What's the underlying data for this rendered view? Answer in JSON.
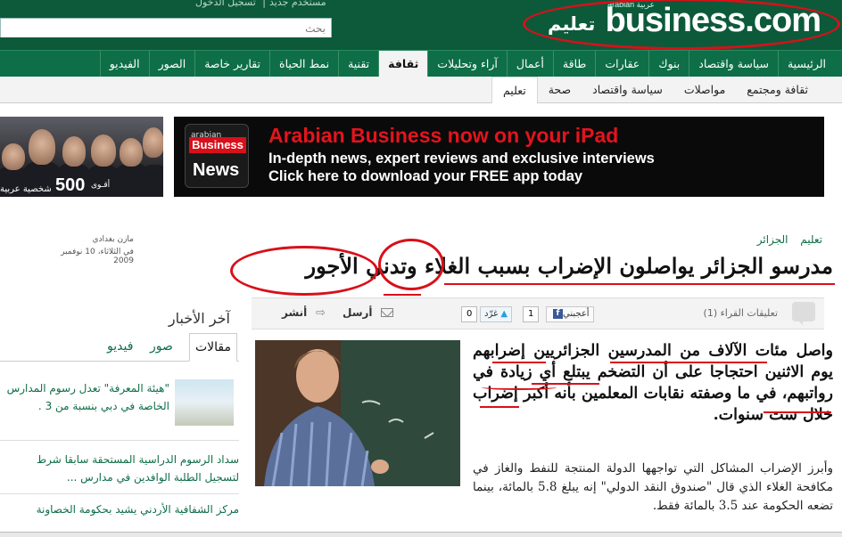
{
  "header": {
    "login_link": "تسجيل الدخول",
    "new_user_link": "مستخدم جديد",
    "search_placeholder": "بحث",
    "logo_small": "arabian عربية",
    "logo_main": "business.com",
    "logo_section": "تعليم"
  },
  "nav": {
    "items": [
      "الرئيسية",
      "سياسة واقتصاد",
      "بنوك",
      "عقارات",
      "طاقة",
      "أعمال",
      "آراء وتحليلات",
      "ثقافة",
      "تقنية",
      "نمط الحياة",
      "تقارير خاصة",
      "الصور",
      "الفيديو"
    ]
  },
  "subnav": {
    "items": [
      "ثقافة ومجتمع",
      "مواصلات",
      "سياسة واقتصاد",
      "صحة",
      "تعليم"
    ]
  },
  "banner_left": {
    "number": "500",
    "caption_right": "أقـوى",
    "caption_left": "شخصية عربية"
  },
  "banner_ipad": {
    "logo_small": "arabian",
    "logo_brand": "Business",
    "logo_news": "News",
    "line1": "Arabian Business now on your iPad",
    "line2": "In-depth news, expert reviews and exclusive interviews",
    "line3": "Click here to download your FREE app today"
  },
  "article": {
    "breadcrumb": [
      "تعليم",
      "الجزائر"
    ],
    "author": "مازن بغدادي",
    "date": "في الثلاثاء، 10 نوفمبر 2009",
    "headline": "مدرسو الجزائر يواصلون الإضراب بسبب الغلاء وتدني الأجور",
    "paragraph1": "واصل مئات الآلاف من المدرسين الجزائريين إضرابهم يوم الاثنين احتجاجا على أن التضخم يبتلع أي زيادة في رواتبهم، في ما وصفته نقابات المعلمين بأنه أكبر إضراب خلال ست سنوات.",
    "paragraph2": "وأبرز الإضراب المشاكل التي تواجهها الدولة المنتجة للنفط والغاز في مكافحة الغلاء الذي قال \"صندوق النقد الدولي\" إنه يبلغ 5.8 بالمائة، بينما تضعه الحكومة عند 3.5 بالمائة فقط."
  },
  "toolbar": {
    "comments": "تعليقات القراء (1)",
    "like_label": "أعجبني",
    "like_count": "1",
    "tweet_label": "غرّد",
    "tweet_count": "0",
    "send_label": "أرسل",
    "share_label": "أنشر"
  },
  "sidebar": {
    "title": "آخر الأخبار",
    "tabs": [
      "مقالات",
      "صور",
      "فيديو"
    ],
    "items": [
      "\"هيئة المعرفة\" تعدل رسوم المدارس الخاصة في دبي بنسبة من 3 .",
      "سداد الرسوم الدراسية المستحقة سابقا شرط لتسجيل الطلبة الوافدين في مدارس ...",
      "مركز الشفافية الأردني يشيد بحكومة الخصاونة"
    ]
  },
  "colors": {
    "header_green": "#0c5a3a",
    "nav_green": "#0e6e47",
    "annotation_red": "#d8101a",
    "ipad_red": "#e3141d"
  }
}
